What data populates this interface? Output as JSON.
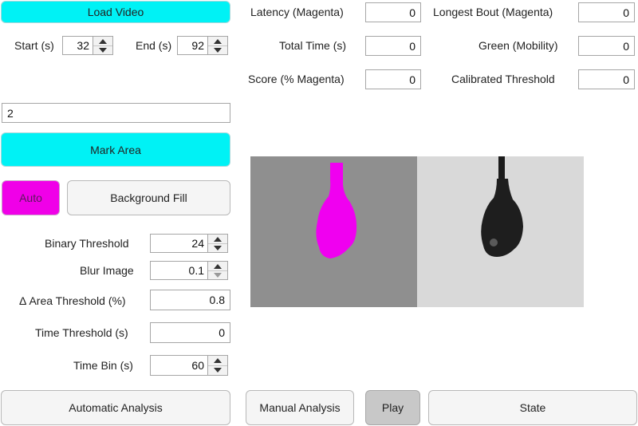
{
  "colors": {
    "accent_cyan": "#00f2f5",
    "accent_magenta": "#f000e8",
    "play_gray": "#c8c8c8",
    "left_frame_bg": "#8f8f8f",
    "right_frame_bg": "#d9d9d9"
  },
  "load_video_label": "Load Video",
  "start": {
    "label": "Start (s)",
    "value": "32"
  },
  "end": {
    "label": "End (s)",
    "value": "92"
  },
  "area_input_value": "2",
  "mark_area_label": "Mark Area",
  "auto_label": "Auto",
  "background_fill_label": "Background Fill",
  "params": {
    "binary_threshold": {
      "label": "Binary Threshold",
      "value": "24"
    },
    "blur_image": {
      "label": "Blur Image",
      "value": "0.1"
    },
    "delta_area_threshold": {
      "label": "Δ Area Threshold (%)",
      "value": "0.8"
    },
    "time_threshold": {
      "label": "Time Threshold (s)",
      "value": "0"
    },
    "time_bin": {
      "label": "Time Bin (s)",
      "value": "60"
    }
  },
  "metrics": {
    "latency": {
      "label": "Latency (Magenta)",
      "value": "0"
    },
    "total_time": {
      "label": "Total Time (s)",
      "value": "0"
    },
    "score": {
      "label": "Score (% Magenta)",
      "value": "0"
    },
    "longest_bout": {
      "label": "Longest Bout (Magenta)",
      "value": "0"
    },
    "green_mobility": {
      "label": "Green (Mobility)",
      "value": "0"
    },
    "calibrated_threshold": {
      "label": "Calibrated Threshold",
      "value": "0"
    }
  },
  "bottom": {
    "automatic_analysis": "Automatic Analysis",
    "manual_analysis": "Manual Analysis",
    "play": "Play",
    "state": "State"
  }
}
